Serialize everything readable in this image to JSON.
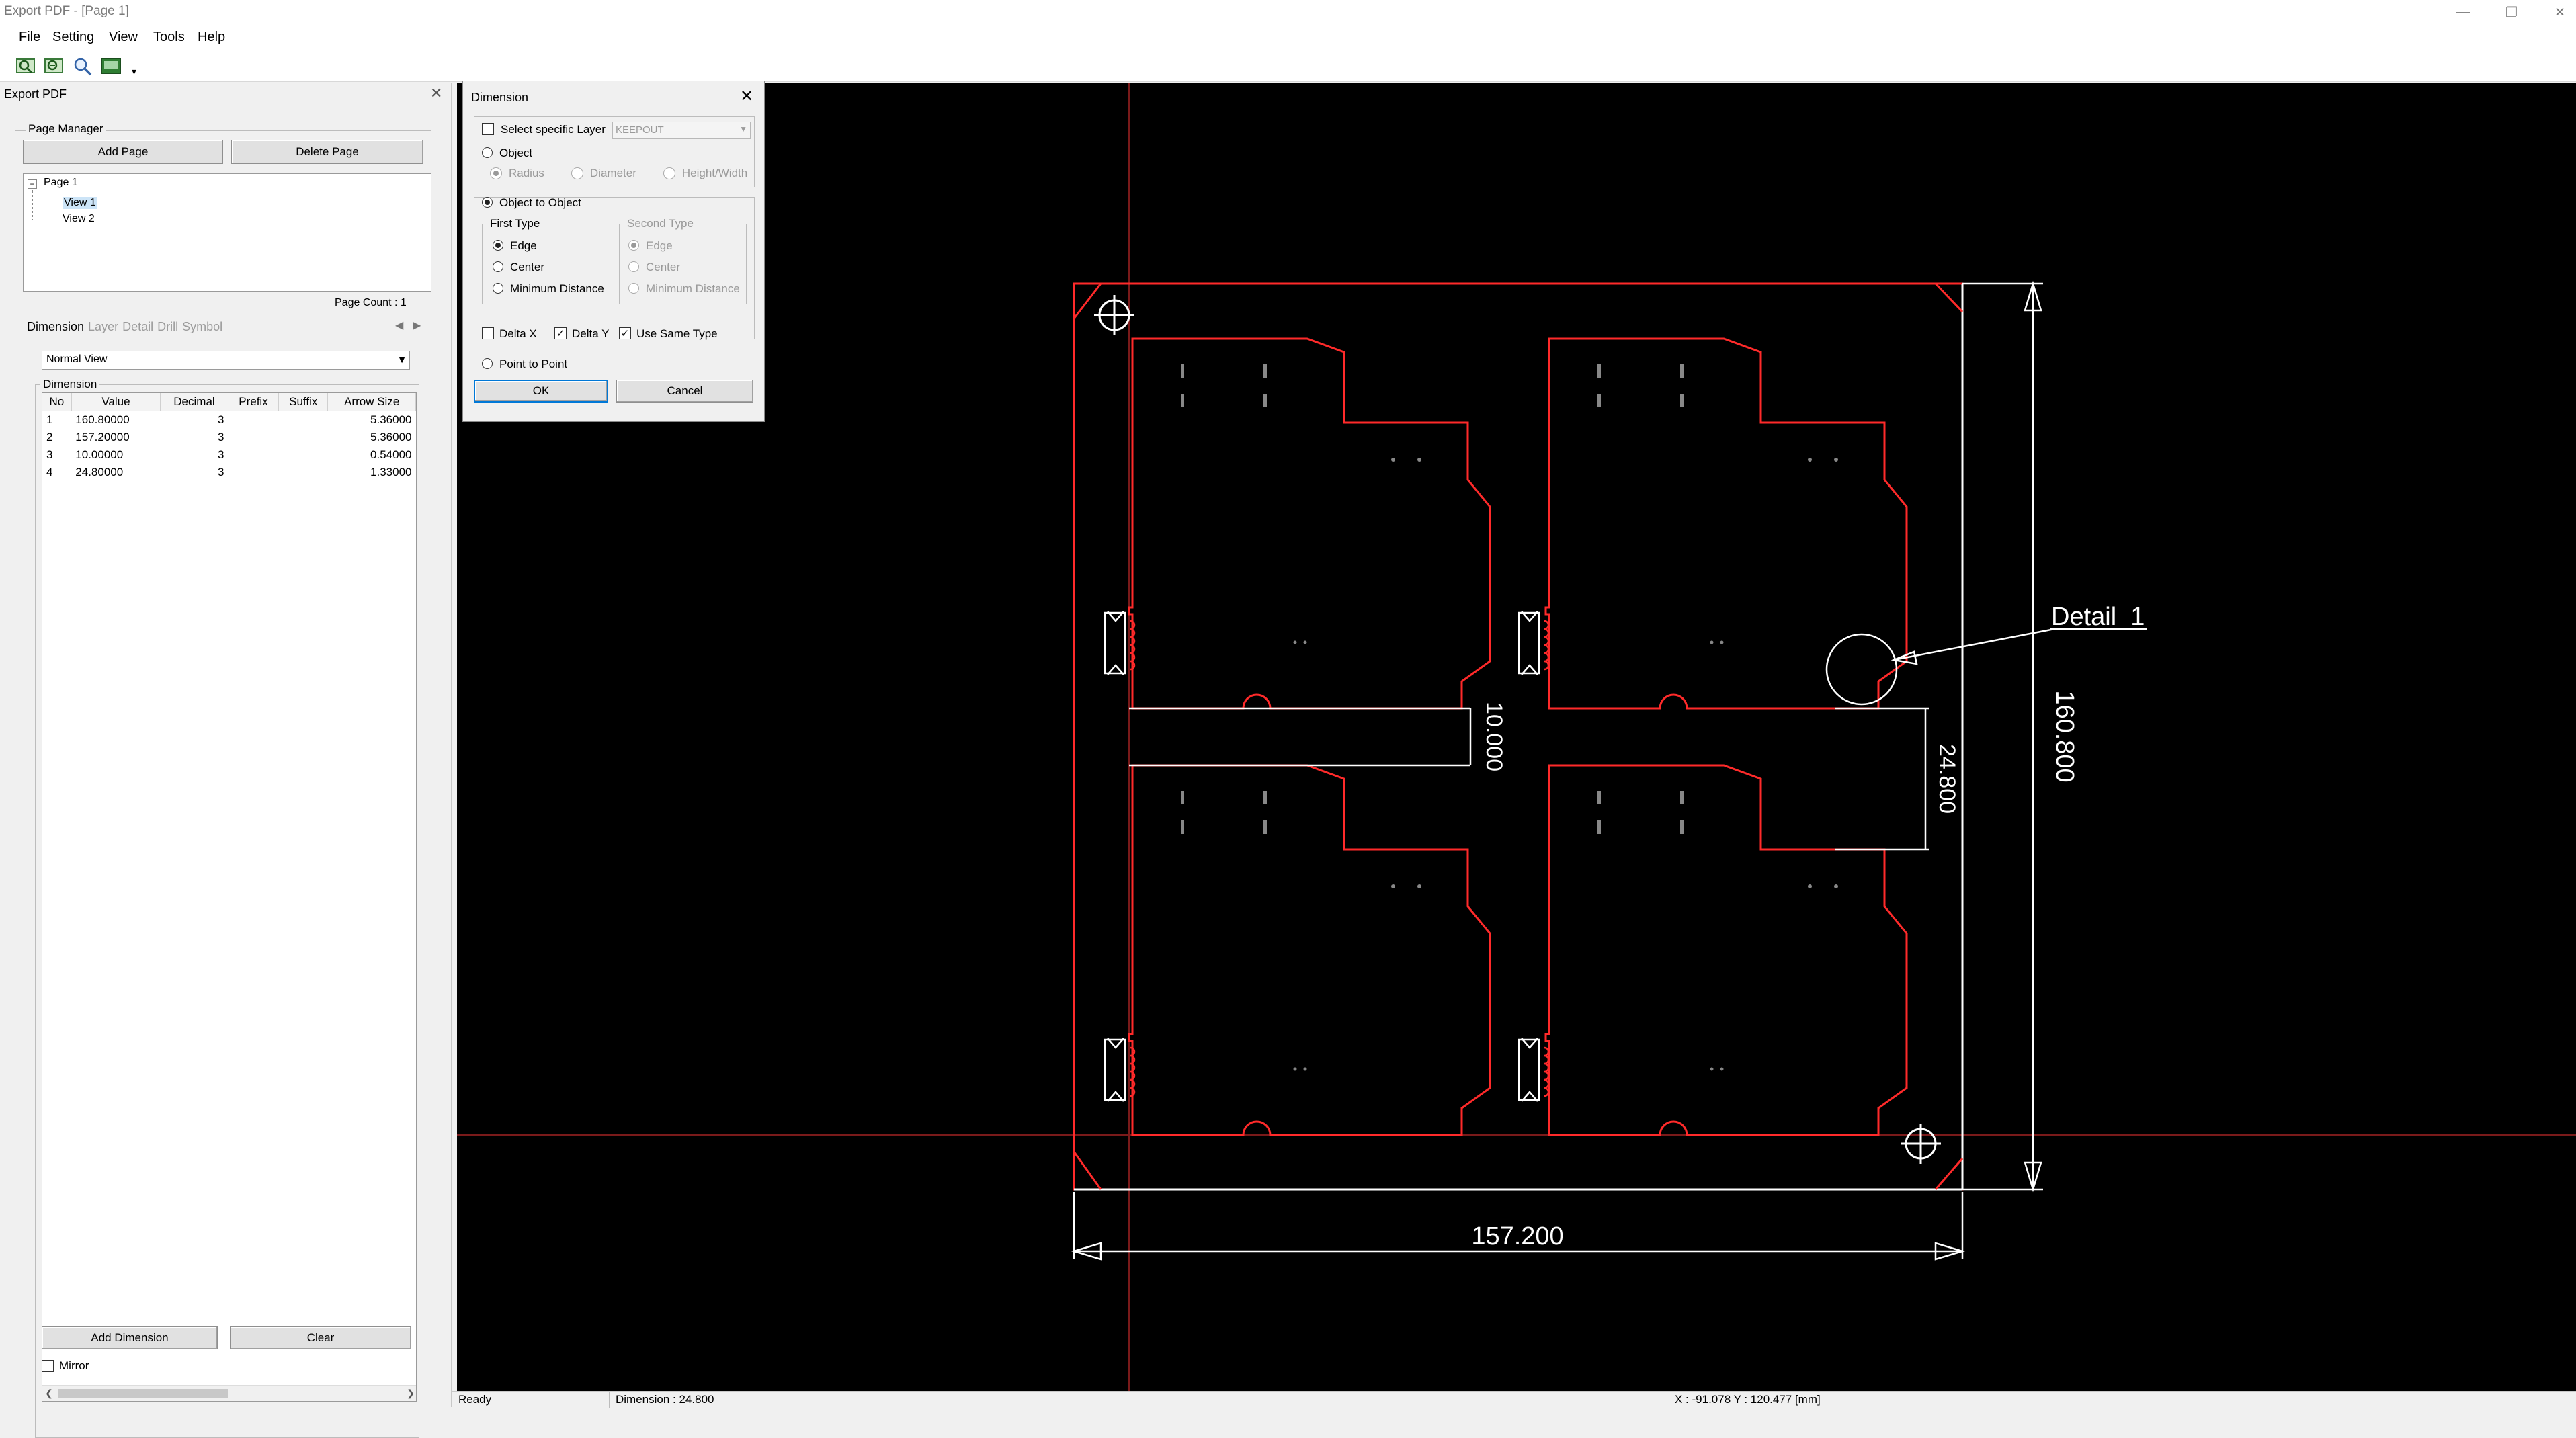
{
  "window": {
    "title": "Export PDF - [Page 1]"
  },
  "menu": [
    {
      "label": "File"
    },
    {
      "label": "Setting"
    },
    {
      "label": "View"
    },
    {
      "label": "Tools"
    },
    {
      "label": "Help"
    }
  ],
  "toolbar": {
    "icons": [
      "zoom-in-icon",
      "zoom-out-icon",
      "zoom-fit-icon",
      "export-image-icon"
    ]
  },
  "panel": {
    "title": "Export PDF",
    "page_manager": {
      "label": "Page Manager",
      "add_page": "Add Page",
      "delete_page": "Delete Page",
      "tree": {
        "root": "Page 1",
        "children": [
          "View 1",
          "View 2"
        ]
      },
      "page_count": "Page Count : 1"
    },
    "tabs": [
      "Dimension",
      "Layer",
      "Detail",
      "Drill",
      "Symbol"
    ],
    "view_select": "Normal View",
    "dimension_group": "Dimension",
    "table": {
      "headers": [
        "No",
        "Value",
        "Decimal",
        "Prefix",
        "Suffix",
        "Arrow Size"
      ],
      "rows": [
        [
          "1",
          "160.80000",
          "3",
          "",
          "",
          "5.36000"
        ],
        [
          "2",
          "157.20000",
          "3",
          "",
          "",
          "5.36000"
        ],
        [
          "3",
          "10.00000",
          "3",
          "",
          "",
          "0.54000"
        ],
        [
          "4",
          "24.80000",
          "3",
          "",
          "",
          "1.33000"
        ]
      ]
    },
    "add_dimension": "Add Dimension",
    "clear": "Clear",
    "mirror": "Mirror"
  },
  "dialog": {
    "title": "Dimension",
    "select_layer": "Select specific Layer",
    "layer_value": "KEEPOUT",
    "object": "Object",
    "object_opts": [
      "Radius",
      "Diameter",
      "Height/Width"
    ],
    "obj_to_obj": "Object to Object",
    "first_type": "First Type",
    "first_opts": [
      "Edge",
      "Center",
      "Minimum Distance"
    ],
    "second_type": "Second Type",
    "second_opts": [
      "Edge",
      "Center",
      "Minimum Distance"
    ],
    "delta_x": "Delta X",
    "delta_y": "Delta Y",
    "use_same_type": "Use Same Type",
    "point_to_point": "Point to Point",
    "ok": "OK",
    "cancel": "Cancel"
  },
  "canvas": {
    "dim_width": "157.200",
    "dim_height": "160.800",
    "dim_gap": "10.000",
    "dim_slot": "24.800",
    "detail_label": "Detail_1",
    "colors": {
      "background": "#000000",
      "outline": "#ff2a2a",
      "dimension": "#ffffff",
      "crosshair": "#8a1a1a"
    }
  },
  "status": {
    "ready": "Ready",
    "dimension": "Dimension : 24.800",
    "coords": "X : -91.078  Y : 120.477 [mm]"
  }
}
